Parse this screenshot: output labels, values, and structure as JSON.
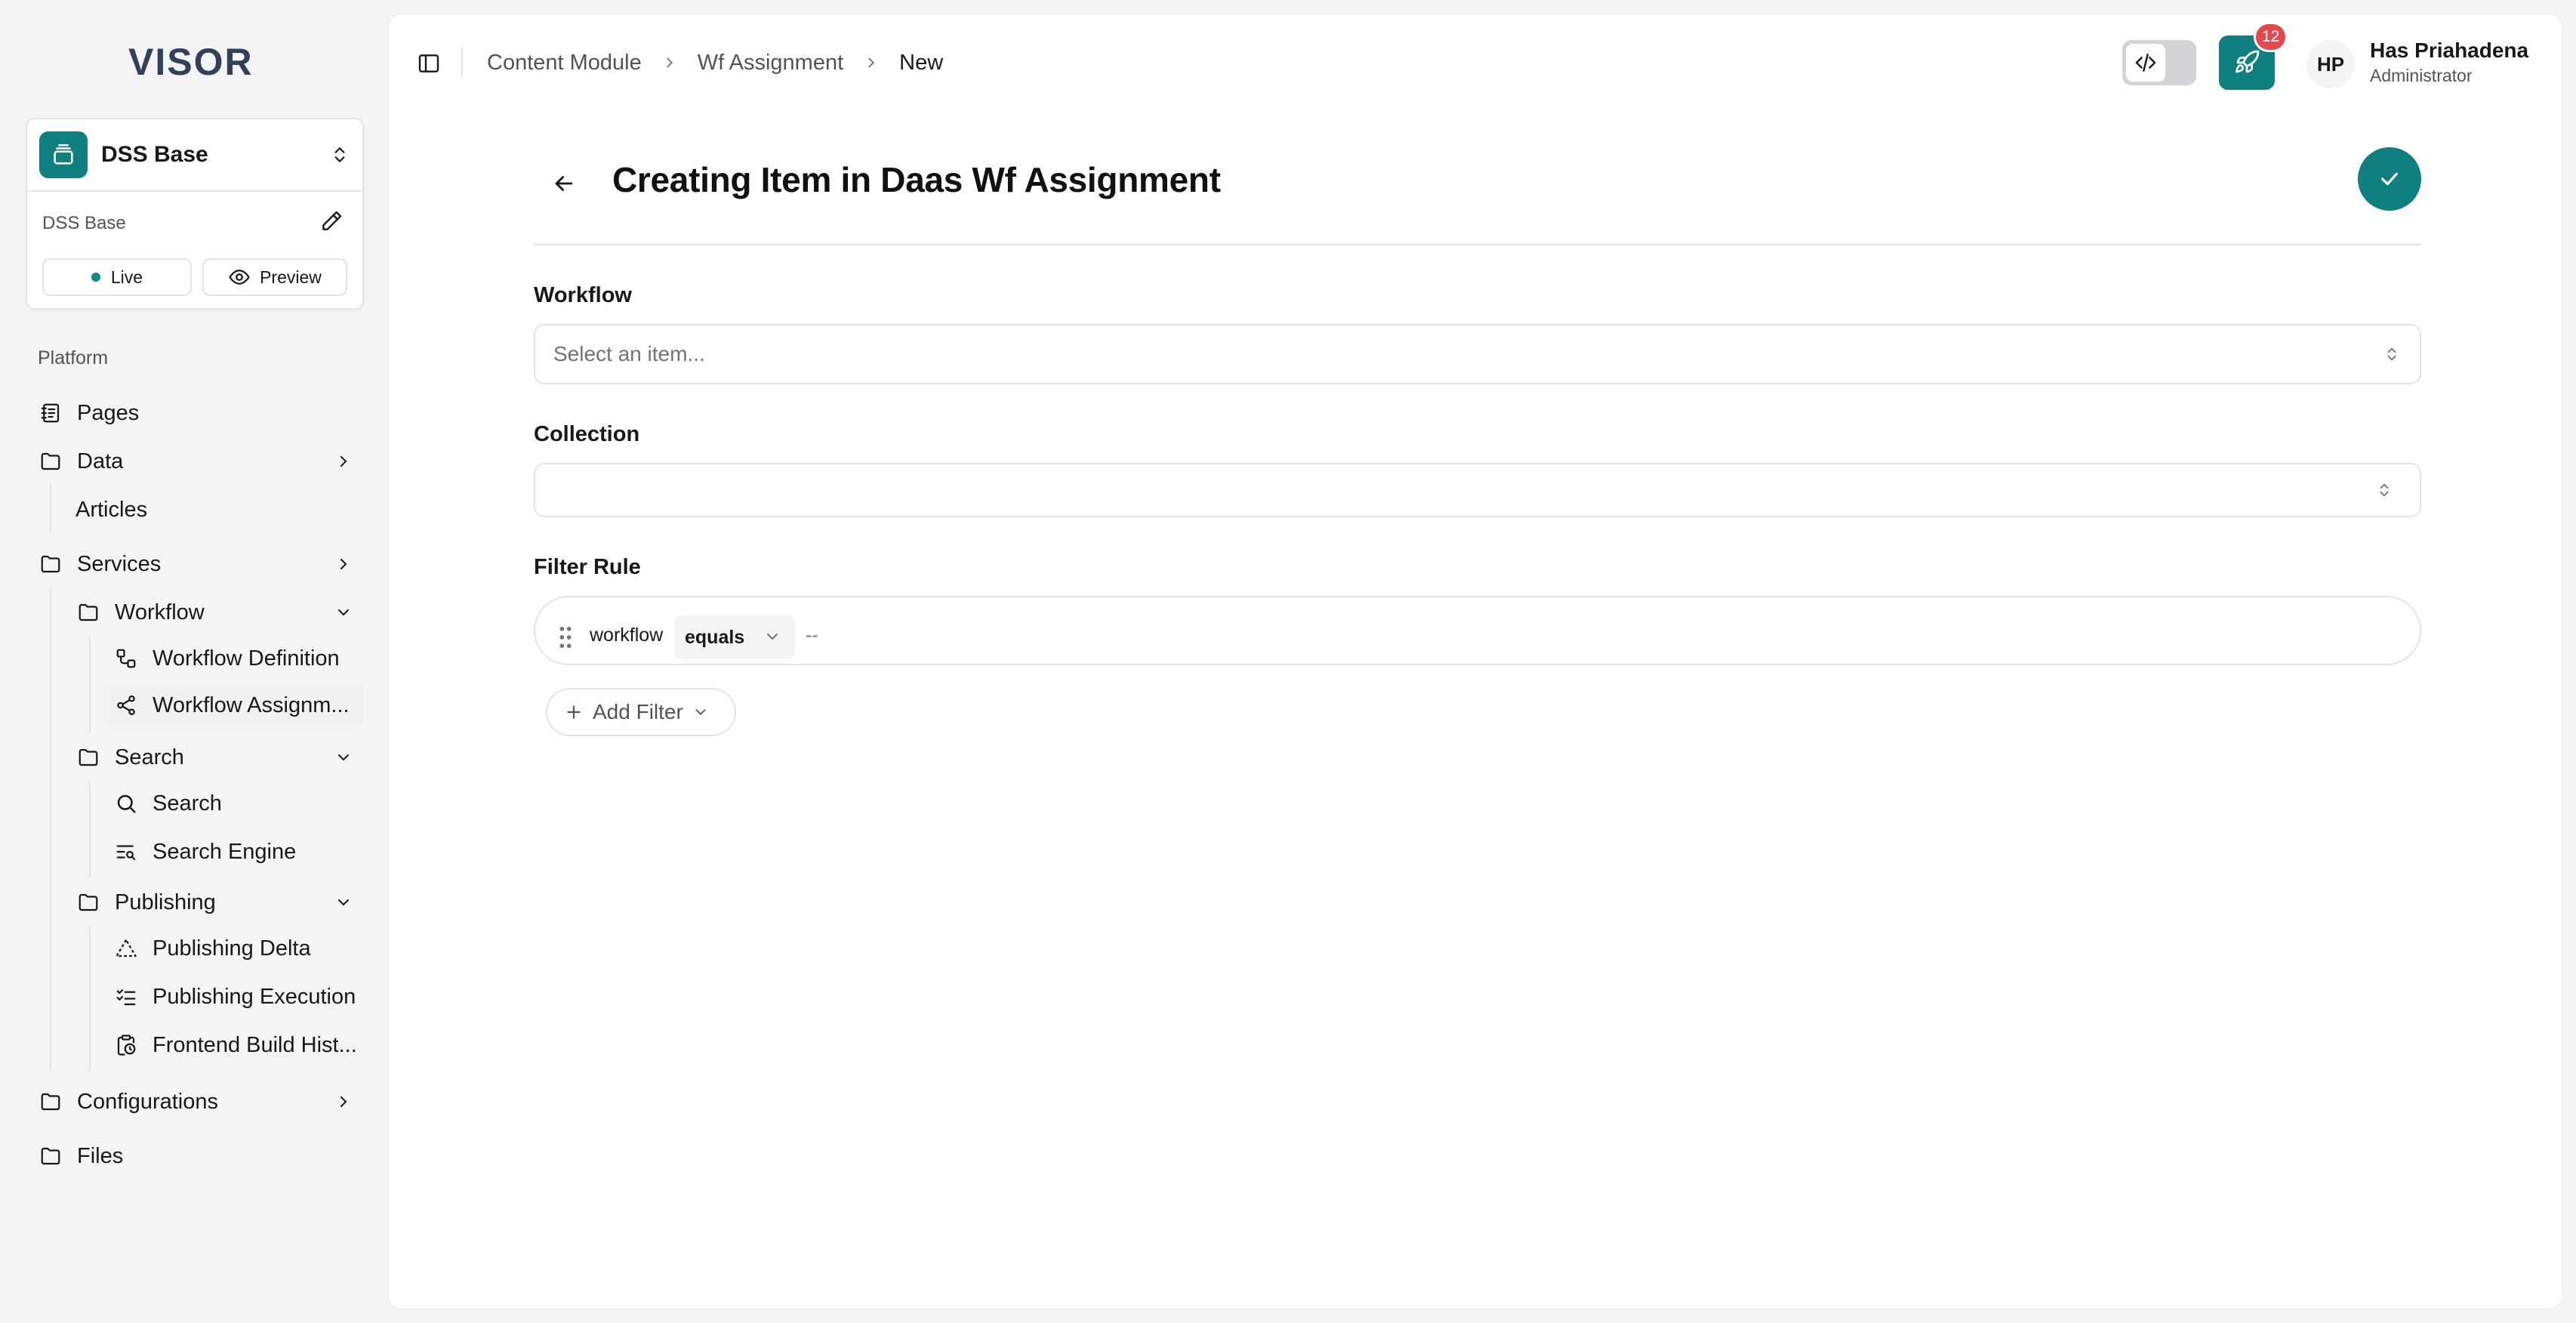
{
  "brand": {
    "logo_text": "VISOR",
    "accent": "#0f7f7f"
  },
  "project": {
    "name": "DSS Base",
    "subtitle": "DSS Base",
    "live_label": "Live",
    "preview_label": "Preview"
  },
  "nav": {
    "group_label": "Platform",
    "pages": "Pages",
    "data": "Data",
    "articles": "Articles",
    "services": "Services",
    "workflow": "Workflow",
    "workflow_definition": "Workflow Definition",
    "workflow_assignment": "Workflow Assignm...",
    "search_folder": "Search",
    "search": "Search",
    "search_engine": "Search Engine",
    "publishing": "Publishing",
    "publishing_delta": "Publishing Delta",
    "publishing_execution": "Publishing Execution",
    "frontend_build": "Frontend Build Hist...",
    "configurations": "Configurations",
    "files": "Files"
  },
  "header": {
    "breadcrumb": [
      "Content Module",
      "Wf Assignment",
      "New"
    ],
    "notification_count": "12",
    "user": {
      "initials": "HP",
      "name": "Has Priahadena",
      "role": "Administrator"
    }
  },
  "form": {
    "title": "Creating Item in Daas Wf Assignment",
    "workflow_label": "Workflow",
    "workflow_placeholder": "Select an item...",
    "collection_label": "Collection",
    "collection_value": "",
    "filter_rule_label": "Filter Rule",
    "filter": {
      "field": "workflow",
      "operator": "equals",
      "value": "--"
    },
    "add_filter_label": "Add Filter"
  }
}
